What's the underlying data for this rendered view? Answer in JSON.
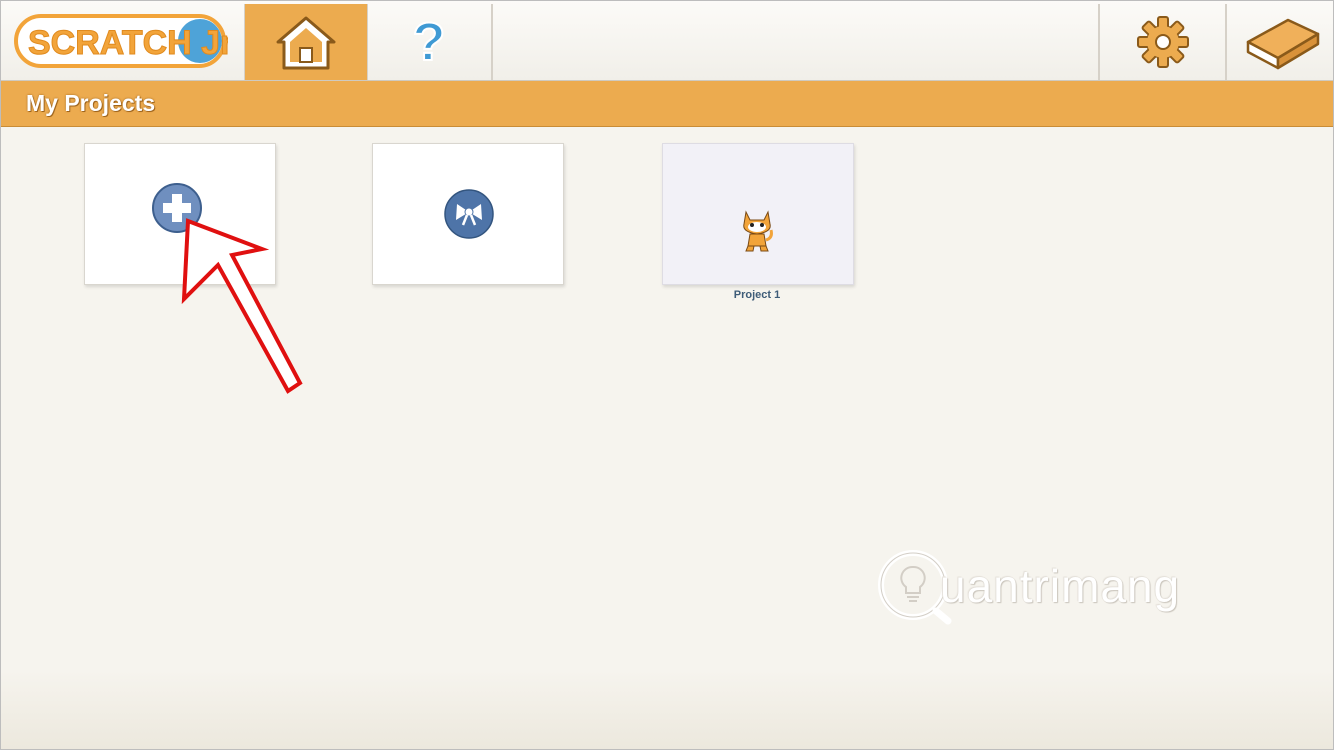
{
  "app": {
    "logo_text": "SCRATCH Jr"
  },
  "nav": {
    "home_icon": "house-icon",
    "help_icon": "question-mark-icon",
    "settings_icon": "gear-icon",
    "book_icon": "book-icon"
  },
  "page": {
    "title": "My Projects"
  },
  "projects": [
    {
      "kind": "new",
      "icon": "plus-icon"
    },
    {
      "kind": "samples",
      "icon": "bow-icon"
    },
    {
      "kind": "project",
      "name": "Project 1",
      "icon": "cat-sprite-icon"
    }
  ],
  "watermark": {
    "text": "uantrimang"
  },
  "colors": {
    "accent_orange": "#ecab4f",
    "button_blue": "#4e74a8",
    "arrow_red": "#e01010",
    "background": "#f6f4ee"
  }
}
